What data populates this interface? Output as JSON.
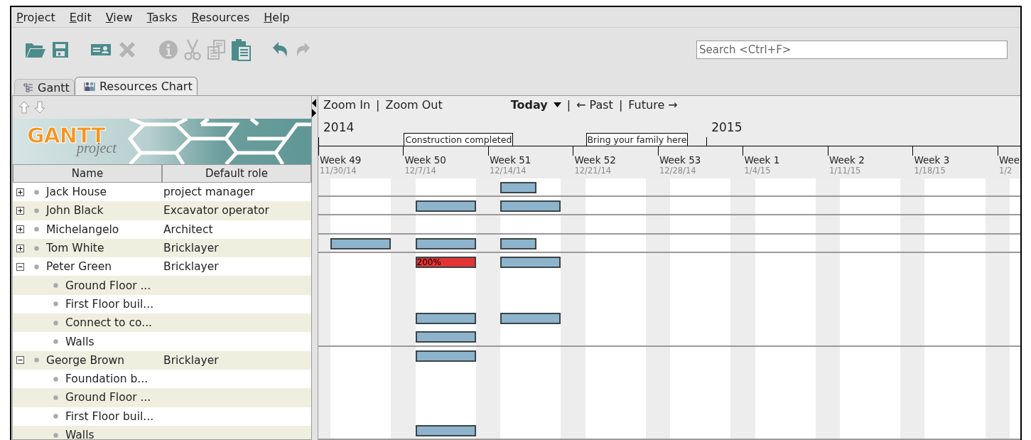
{
  "menu": [
    {
      "label": "Project"
    },
    {
      "label": "Edit"
    },
    {
      "label": "View"
    },
    {
      "label": "Tasks"
    },
    {
      "label": "Resources"
    },
    {
      "label": "Help"
    }
  ],
  "toolbar": {
    "groups": [
      [
        {
          "kind": "open",
          "disabled": false
        },
        {
          "kind": "save",
          "disabled": false
        }
      ],
      [
        {
          "kind": "resource",
          "disabled": false
        },
        {
          "kind": "delete",
          "disabled": true
        }
      ],
      [
        {
          "kind": "info",
          "disabled": true
        },
        {
          "kind": "cut",
          "disabled": true
        },
        {
          "kind": "copy",
          "disabled": true
        },
        {
          "kind": "paste",
          "disabled": false
        }
      ],
      [
        {
          "kind": "undo",
          "disabled": false
        },
        {
          "kind": "redo",
          "disabled": true
        }
      ]
    ]
  },
  "search": {
    "placeholder": "Search <Ctrl+F>"
  },
  "tabs": [
    {
      "label": "Gantt",
      "kind": "gantt",
      "selected": false
    },
    {
      "label": "Resources Chart",
      "kind": "resources",
      "selected": true
    }
  ],
  "logo": {
    "title": "GANTT",
    "subtitle": "project"
  },
  "table": {
    "columns": [
      "Name",
      "Default role"
    ],
    "rows": [
      {
        "name": "Jack House",
        "role": "project manager",
        "expanded": false,
        "weeks": [
          {
            "kind": "free"
          },
          {
            "kind": "free"
          },
          {
            "kind": "partial"
          }
        ]
      },
      {
        "name": "John Black",
        "role": "Excavator operator",
        "expanded": false,
        "weeks": [
          {
            "kind": "free"
          },
          {
            "kind": "full"
          },
          {
            "kind": "full"
          }
        ]
      },
      {
        "name": "Michelangelo",
        "role": "Architect",
        "expanded": false
      },
      {
        "name": "Tom White",
        "role": "Bricklayer",
        "expanded": false,
        "weeks": [
          {
            "kind": "full"
          },
          {
            "kind": "full"
          },
          {
            "kind": "partial"
          }
        ]
      },
      {
        "name": "Peter Green",
        "role": "Bricklayer",
        "expanded": true,
        "weeks": [
          {
            "kind": "free"
          },
          {
            "kind": "overload",
            "load": "200%"
          },
          {
            "kind": "full"
          }
        ],
        "children": [
          {
            "name": "Ground Floor ..."
          },
          {
            "name": "First Floor buil..."
          },
          {
            "name": "Connect to co...",
            "weeks": [
              {
                "kind": "free"
              },
              {
                "kind": "full"
              },
              {
                "kind": "full"
              }
            ]
          },
          {
            "name": "Walls",
            "weeks": [
              {
                "kind": "free"
              },
              {
                "kind": "full"
              }
            ]
          }
        ]
      },
      {
        "name": "George Brown",
        "role": "Bricklayer",
        "expanded": true,
        "weeks": [
          {
            "kind": "free"
          },
          {
            "kind": "full"
          }
        ],
        "children": [
          {
            "name": "Foundation b..."
          },
          {
            "name": "Ground Floor ..."
          },
          {
            "name": "First Floor buil..."
          },
          {
            "name": "Walls",
            "weeks": [
              {
                "kind": "free"
              },
              {
                "kind": "full"
              }
            ]
          }
        ]
      }
    ]
  },
  "chart": {
    "nav": [
      {
        "kind": "link",
        "label": "Zoom In"
      },
      {
        "kind": "separator",
        "label": "|"
      },
      {
        "kind": "link",
        "label": "Zoom Out"
      },
      {
        "kind": "dropdown",
        "label": "Today"
      },
      {
        "kind": "separator",
        "label": "|"
      },
      {
        "kind": "link",
        "label": "← Past"
      },
      {
        "kind": "separator",
        "label": "|"
      },
      {
        "kind": "link",
        "label": "Future →"
      }
    ],
    "years": [
      {
        "label": "2014",
        "kind": "start"
      },
      {
        "label": "2015",
        "kind": "new-year"
      }
    ],
    "milestones": [
      {
        "label": "Construction completed",
        "kind": "week-2-sunday"
      },
      {
        "label": "Bring your family here",
        "kind": "week-4-monday"
      }
    ],
    "weeks": [
      {
        "label": "Week 49",
        "date": "11/30/14"
      },
      {
        "label": "Week 50",
        "date": "12/7/14"
      },
      {
        "label": "Week 51",
        "date": "12/14/14"
      },
      {
        "label": "Week 52",
        "date": "12/21/14"
      },
      {
        "label": "Week 53",
        "date": "12/28/14"
      },
      {
        "label": "Week 1",
        "date": "1/4/15"
      },
      {
        "label": "Week 2",
        "date": "1/11/15"
      },
      {
        "label": "Week 3",
        "date": "1/18/15"
      },
      {
        "label": "Wee",
        "date": "1/2"
      }
    ]
  }
}
